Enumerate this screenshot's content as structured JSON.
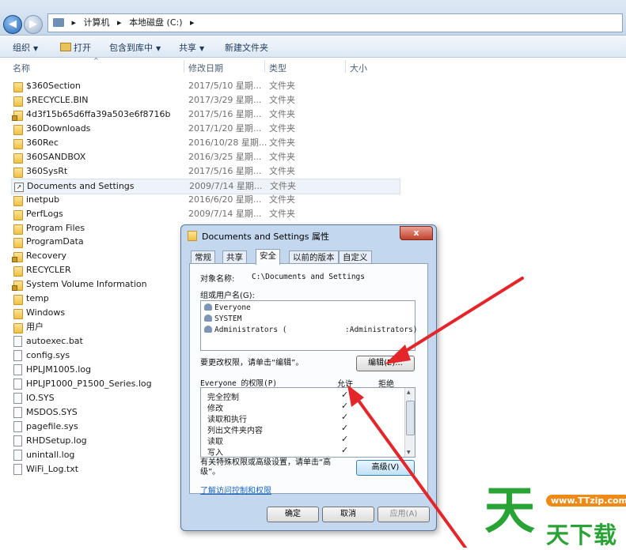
{
  "address": {
    "path": [
      "计算机",
      "本地磁盘 (C:)"
    ]
  },
  "toolbar": {
    "organize": "组织",
    "open": "打开",
    "include_in_library": "包含到库中",
    "share": "共享",
    "new_folder": "新建文件夹"
  },
  "columns": {
    "name": "名称",
    "modified": "修改日期",
    "type": "类型",
    "size": "大小"
  },
  "files": [
    {
      "name": "$360Section",
      "date": "2017/5/10 星期...",
      "type": "文件夹",
      "kind": "folder"
    },
    {
      "name": "$RECYCLE.BIN",
      "date": "2017/3/29 星期...",
      "type": "文件夹",
      "kind": "folder"
    },
    {
      "name": "4d3f15b65d6ffa39a503e6f8716b",
      "date": "2017/5/16 星期...",
      "type": "文件夹",
      "kind": "folder-locked"
    },
    {
      "name": "360Downloads",
      "date": "2017/1/20 星期...",
      "type": "文件夹",
      "kind": "folder"
    },
    {
      "name": "360Rec",
      "date": "2016/10/28 星期...",
      "type": "文件夹",
      "kind": "folder"
    },
    {
      "name": "360SANDBOX",
      "date": "2016/3/25 星期...",
      "type": "文件夹",
      "kind": "folder"
    },
    {
      "name": "360SysRt",
      "date": "2017/5/16 星期...",
      "type": "文件夹",
      "kind": "folder"
    },
    {
      "name": "Documents and Settings",
      "date": "2009/7/14 星期...",
      "type": "文件夹",
      "kind": "shortcut"
    },
    {
      "name": "inetpub",
      "date": "2016/6/20 星期...",
      "type": "文件夹",
      "kind": "folder"
    },
    {
      "name": "PerfLogs",
      "date": "2009/7/14 星期...",
      "type": "文件夹",
      "kind": "folder"
    },
    {
      "name": "Program Files",
      "date": "",
      "type": "",
      "kind": "folder"
    },
    {
      "name": "ProgramData",
      "date": "",
      "type": "",
      "kind": "folder"
    },
    {
      "name": "Recovery",
      "date": "",
      "type": "",
      "kind": "folder-locked"
    },
    {
      "name": "RECYCLER",
      "date": "",
      "type": "",
      "kind": "folder"
    },
    {
      "name": "System Volume Information",
      "date": "",
      "type": "",
      "kind": "folder-locked"
    },
    {
      "name": "temp",
      "date": "",
      "type": "",
      "kind": "folder"
    },
    {
      "name": "Windows",
      "date": "",
      "type": "",
      "kind": "folder"
    },
    {
      "name": "用户",
      "date": "",
      "type": "",
      "kind": "folder"
    },
    {
      "name": "autoexec.bat",
      "date": "",
      "type": "",
      "kind": "file"
    },
    {
      "name": "config.sys",
      "date": "",
      "type": "",
      "kind": "file"
    },
    {
      "name": "HPLJM1005.log",
      "date": "",
      "type": "",
      "kind": "file"
    },
    {
      "name": "HPLJP1000_P1500_Series.log",
      "date": "",
      "type": "",
      "kind": "file"
    },
    {
      "name": "IO.SYS",
      "date": "",
      "type": "",
      "kind": "file"
    },
    {
      "name": "MSDOS.SYS",
      "date": "",
      "type": "",
      "kind": "file"
    },
    {
      "name": "pagefile.sys",
      "date": "",
      "type": "",
      "kind": "file"
    },
    {
      "name": "RHDSetup.log",
      "date": "",
      "type": "",
      "kind": "file"
    },
    {
      "name": "unintall.log",
      "date": "",
      "type": "",
      "kind": "file"
    },
    {
      "name": "WiFi_Log.txt",
      "date": "",
      "type": "",
      "kind": "file"
    }
  ],
  "dialog": {
    "title": "Documents and Settings 属性",
    "close": "x",
    "tabs": [
      "常规",
      "共享",
      "安全",
      "以前的版本",
      "自定义"
    ],
    "active_tab": "安全",
    "object_label": "对象名称:",
    "object_value": "C:\\Documents and Settings",
    "groups_label": "组或用户名(G):",
    "users": [
      "Everyone",
      "SYSTEM",
      "Administrators (",
      ":Administrators)"
    ],
    "edit_hint": "要更改权限，请单击“编辑”。",
    "edit_button": "编辑(E)...",
    "perm_header": "Everyone 的权限(P)",
    "allow": "允许",
    "deny": "拒绝",
    "permissions": [
      "完全控制",
      "修改",
      "读取和执行",
      "列出文件夹内容",
      "读取",
      "写入"
    ],
    "allowed_marks": "✓",
    "advanced_hint": "有关特殊权限或高级设置，请单击“高级”。",
    "advanced_button": "高级(V)",
    "help_link": "了解访问控制和权限",
    "ok": "确定",
    "cancel": "取消",
    "apply": "应用(A)"
  },
  "watermark": {
    "url": "www.TTzip.com",
    "big": "天",
    "small": "天下载"
  }
}
